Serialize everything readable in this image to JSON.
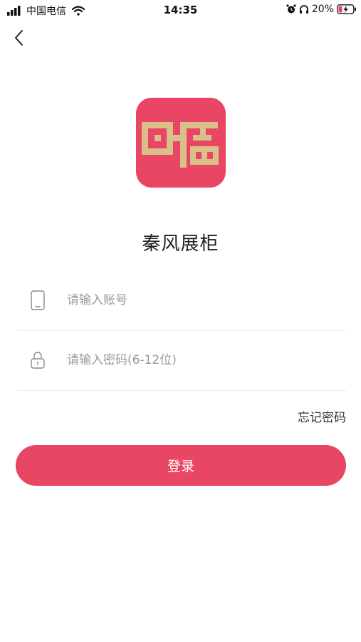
{
  "status_bar": {
    "carrier": "中国电信",
    "time": "14:35",
    "battery": "20%"
  },
  "app": {
    "title": "秦风展柜"
  },
  "form": {
    "account_placeholder": "请输入账号",
    "password_placeholder": "请输入密码(6-12位)",
    "forgot_label": "忘记密码",
    "login_label": "登录"
  },
  "colors": {
    "brand": "#e94565",
    "logo_glyph": "#d9c08a"
  },
  "icons": {
    "back": "chevron-left-icon",
    "account": "phone-icon",
    "password": "lock-icon"
  }
}
